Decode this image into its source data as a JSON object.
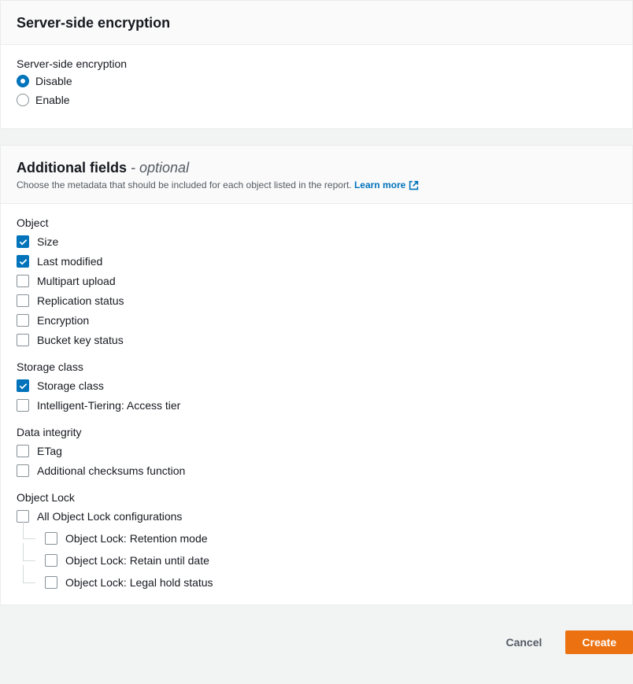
{
  "encryption": {
    "title": "Server-side encryption",
    "field_label": "Server-side encryption",
    "options": {
      "disable": "Disable",
      "enable": "Enable"
    }
  },
  "additional": {
    "title": "Additional fields",
    "optional": " - optional",
    "subtitle": "Choose the metadata that should be included for each object listed in the report. ",
    "learn_more": "Learn more",
    "groups": {
      "object": {
        "label": "Object",
        "items": {
          "size": "Size",
          "last_modified": "Last modified",
          "multipart_upload": "Multipart upload",
          "replication_status": "Replication status",
          "encryption": "Encryption",
          "bucket_key_status": "Bucket key status"
        }
      },
      "storage_class": {
        "label": "Storage class",
        "items": {
          "storage_class": "Storage class",
          "intelligent_tiering": "Intelligent-Tiering: Access tier"
        }
      },
      "data_integrity": {
        "label": "Data integrity",
        "items": {
          "etag": "ETag",
          "additional_checksums": "Additional checksums function"
        }
      },
      "object_lock": {
        "label": "Object Lock",
        "items": {
          "all": "All Object Lock configurations",
          "retention_mode": "Object Lock: Retention mode",
          "retain_until": "Object Lock: Retain until date",
          "legal_hold": "Object Lock: Legal hold status"
        }
      }
    }
  },
  "footer": {
    "cancel": "Cancel",
    "create": "Create"
  }
}
